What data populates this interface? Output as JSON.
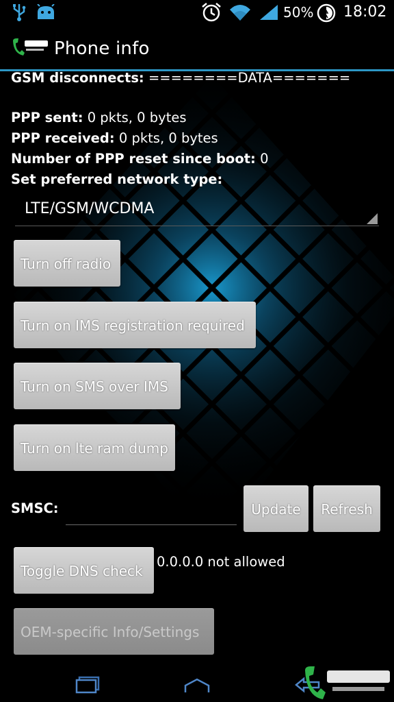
{
  "status_bar": {
    "battery_percent": "50%",
    "time": "18:02",
    "icons": [
      "usb-icon",
      "android-debug-icon",
      "alarm-icon",
      "wifi-icon",
      "signal-icon",
      "battery-icon"
    ]
  },
  "action_bar": {
    "title": "Phone info"
  },
  "info": {
    "gsm_disconnects_label": "GSM disconnects:",
    "gsm_disconnects_value": "========DATA=======",
    "ppp_sent_label": "PPP sent:",
    "ppp_sent_value": "0 pkts, 0 bytes",
    "ppp_received_label": "PPP received:",
    "ppp_received_value": "0 pkts, 0 bytes",
    "ppp_reset_label": "Number of PPP reset since boot:",
    "ppp_reset_value": "0",
    "preferred_network_label": "Set preferred network type:"
  },
  "network_type": {
    "selected": "LTE/GSM/WCDMA"
  },
  "buttons": {
    "turn_off_radio": "Turn off radio",
    "ims_registration": "Turn on IMS registration required",
    "sms_over_ims": "Turn on SMS over IMS",
    "lte_ram_dump": "Turn on lte ram dump",
    "update": "Update",
    "refresh": "Refresh",
    "toggle_dns": "Toggle DNS check",
    "oem_info": "OEM-specific Info/Settings"
  },
  "smsc": {
    "label": "SMSC:",
    "value": ""
  },
  "dns": {
    "status": "0.0.0.0 not allowed"
  },
  "colors": {
    "accent": "#2d97c6",
    "button": "#c8c8c8",
    "background": "#000000"
  }
}
